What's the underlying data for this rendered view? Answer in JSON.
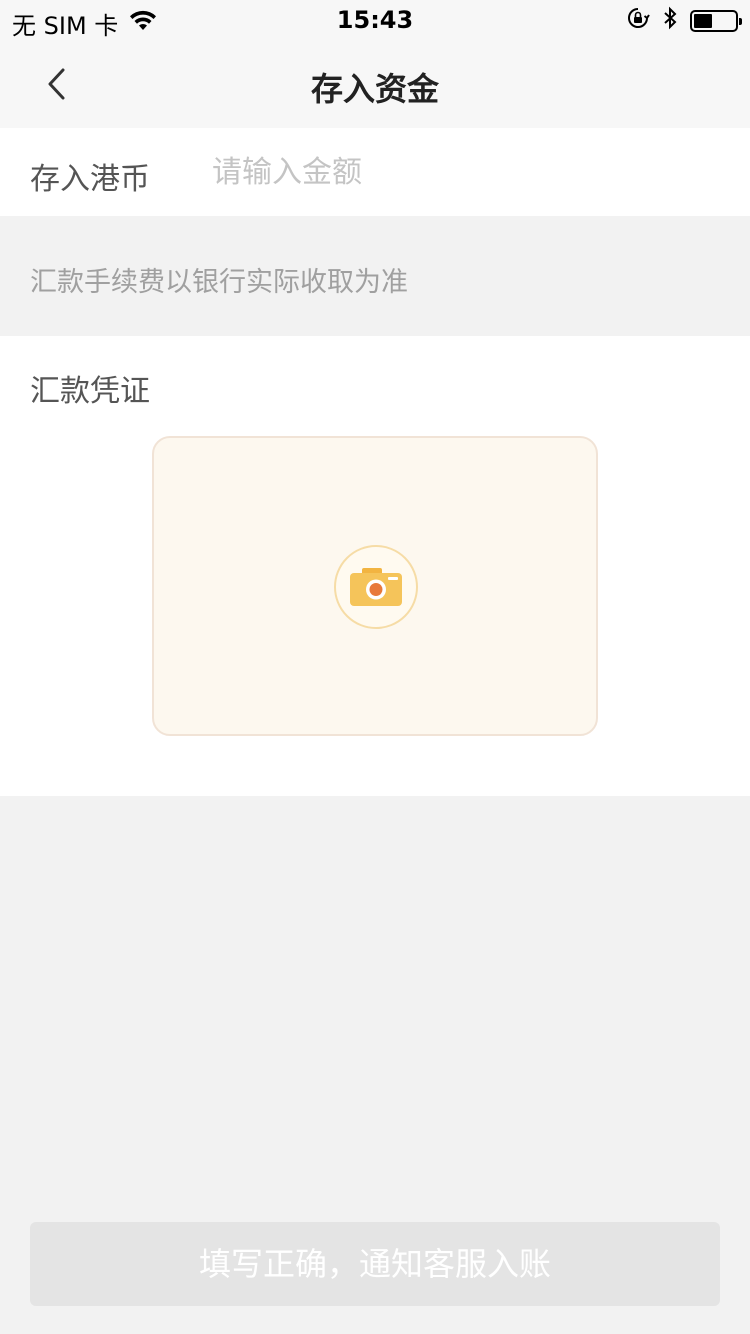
{
  "status_bar": {
    "carrier": "无 SIM 卡",
    "time": "15:43",
    "icons": [
      "wifi-icon",
      "orientation-lock-icon",
      "bluetooth-icon",
      "battery-icon"
    ]
  },
  "nav": {
    "title": "存入资金",
    "back_icon": "chevron-left-icon"
  },
  "amount": {
    "label": "存入港币",
    "placeholder": "请输入金额",
    "value": ""
  },
  "notice": {
    "text": "汇款手续费以银行实际收取为准"
  },
  "voucher": {
    "title": "汇款凭证",
    "upload_icon": "camera-icon"
  },
  "submit": {
    "label": "填写正确，通知客服入账"
  },
  "colors": {
    "accent": "#f5b54a",
    "camera_lens": "#e8793a",
    "upload_bg": "#fdf8ef",
    "button_disabled": "#e4e4e4"
  }
}
